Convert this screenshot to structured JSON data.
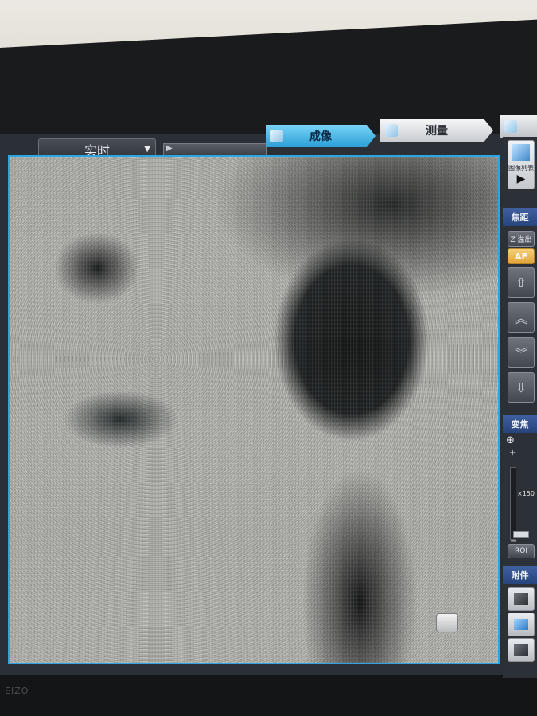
{
  "header": {
    "mode_select": "实时",
    "tabs": [
      {
        "label": "成像",
        "active": true
      },
      {
        "label": "测量",
        "active": false
      }
    ]
  },
  "side_panel": {
    "image_list_label": "图像列表",
    "focus_section": "焦距",
    "z_button": "Z 溢出",
    "af_button": "AF",
    "zoom_section": "变焦",
    "zoom_value": "×150",
    "roi_button": "ROI",
    "accessory_section": "附件"
  },
  "monitor_brand": "EIZO",
  "colors": {
    "accent": "#2ba6e2",
    "active_tab": "#2a9fd6",
    "section_head": "#27447c",
    "af_button": "#e0a43a"
  }
}
